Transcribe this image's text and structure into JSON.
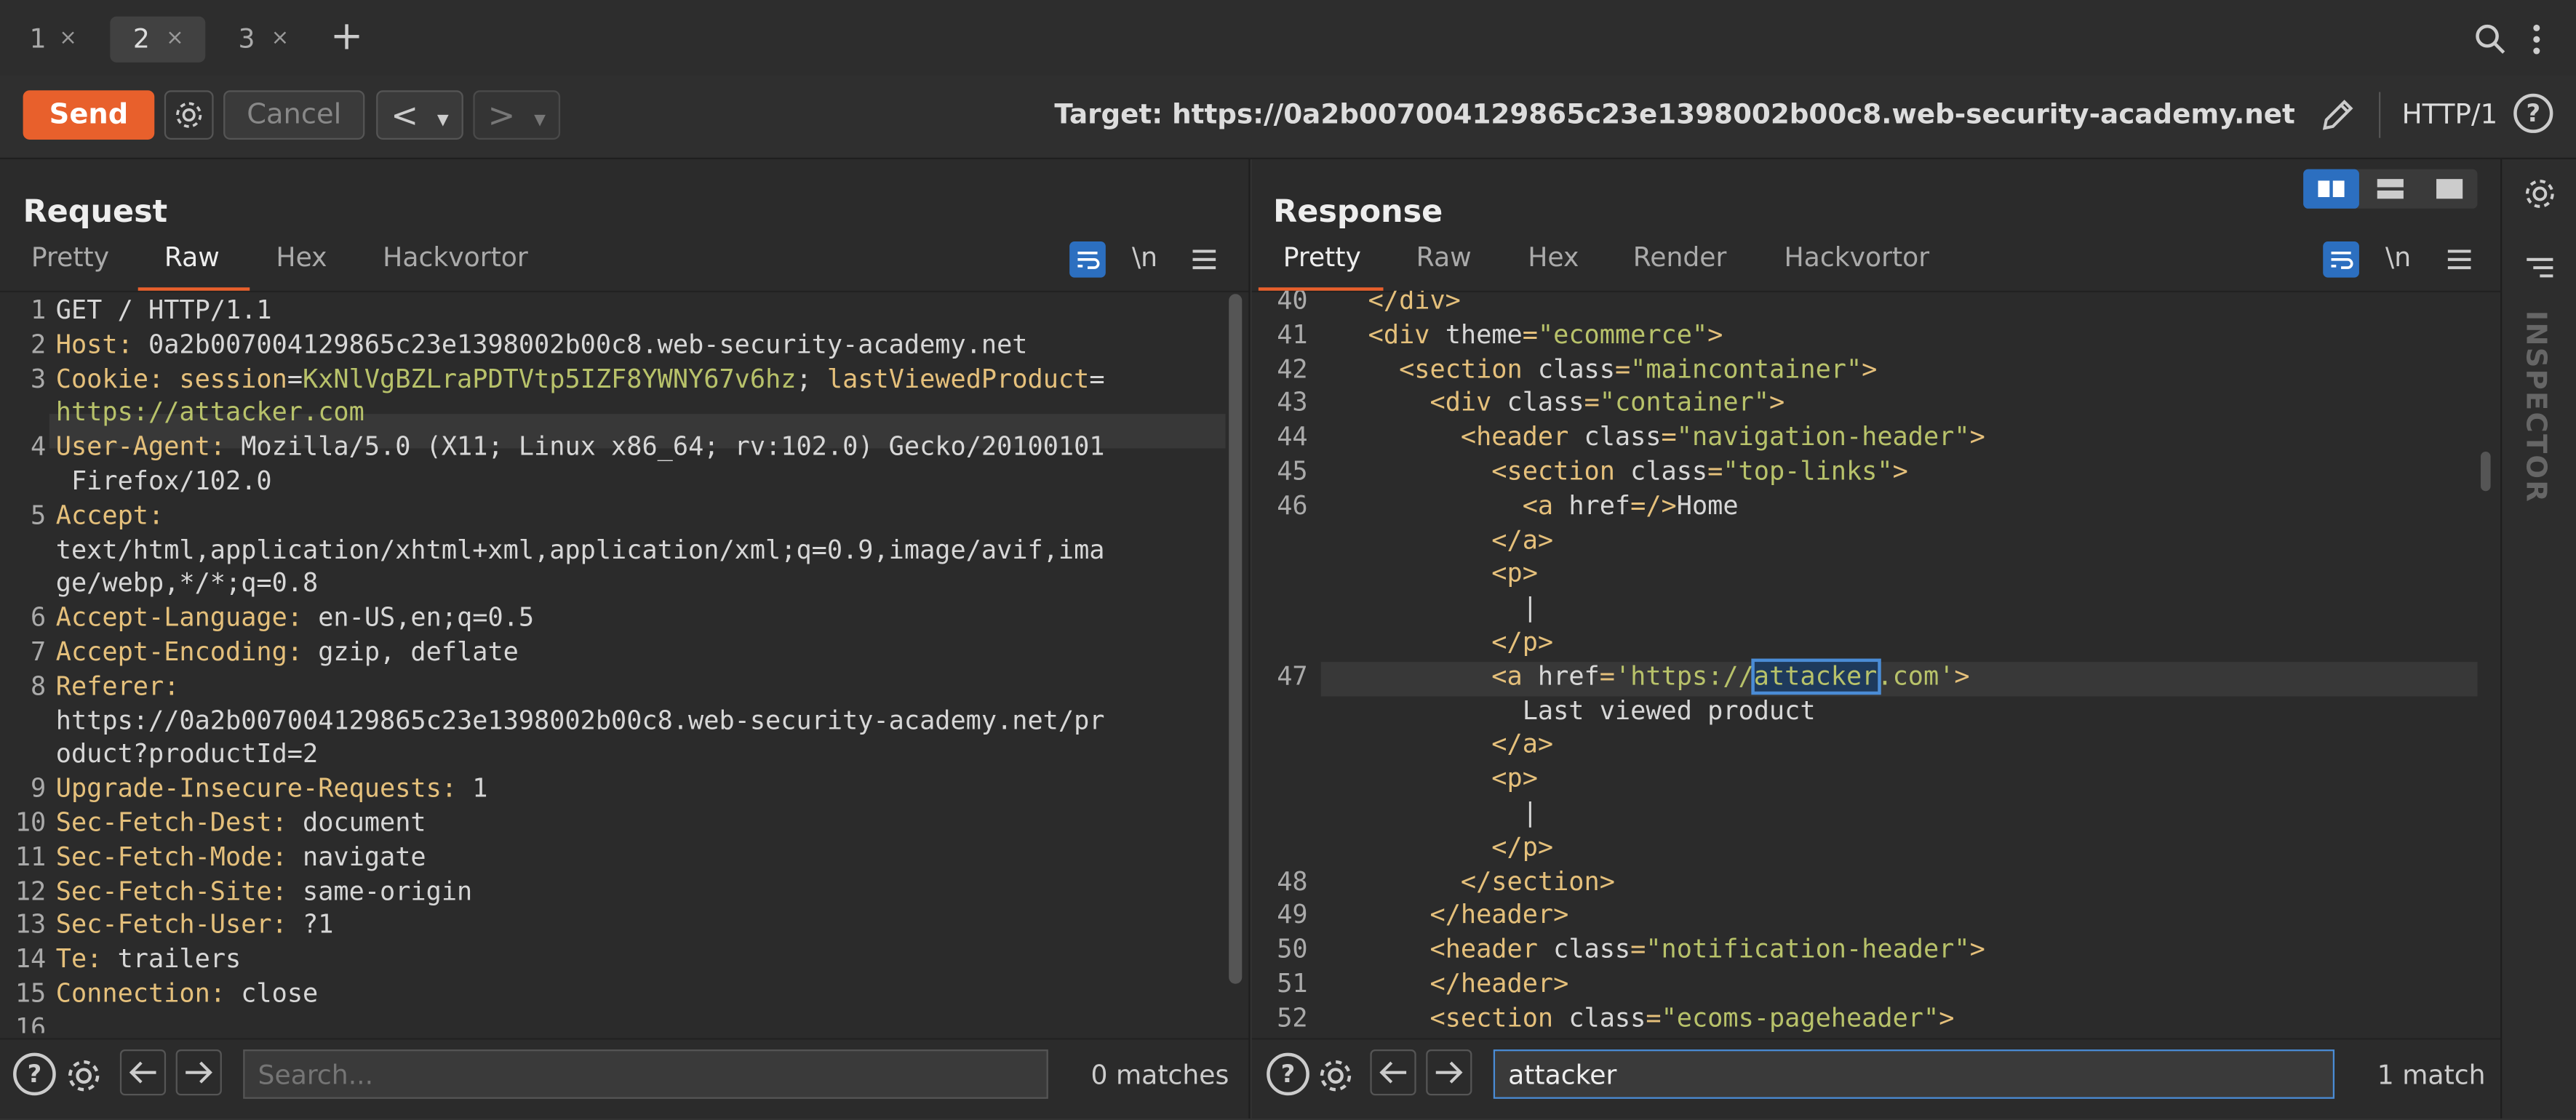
{
  "tabs": [
    {
      "label": "1"
    },
    {
      "label": "2"
    },
    {
      "label": "3"
    }
  ],
  "tab_close": "×",
  "new_tab": "+",
  "toolbar": {
    "send": "Send",
    "cancel": "Cancel",
    "back": "<",
    "forward": ">",
    "dropdown": "▾",
    "target_label": "Target:",
    "target_url": "https://0a2b007004129865c23e1398002b00c8.web-security-academy.net",
    "http_version": "HTTP/1",
    "help": "?"
  },
  "request": {
    "title": "Request",
    "tabs": [
      "Pretty",
      "Raw",
      "Hex",
      "Hackvortor"
    ],
    "active_tab": "Raw",
    "newline_toggle": "\\n",
    "lines": [
      {
        "n": "1",
        "name": "",
        "value": "GET / HTTP/1.1"
      },
      {
        "n": "2",
        "name": "Host",
        "value": " 0a2b007004129865c23e1398002b00c8.web-security-academy.net"
      },
      {
        "n": "3",
        "name": "Cookie",
        "value": ""
      },
      {
        "n": "",
        "name": "",
        "value": "https://attacker.com"
      },
      {
        "n": "4",
        "name": "User-Agent",
        "value": " Mozilla/5.0 (X11; Linux x86_64; rv:102.0) Gecko/20100101"
      },
      {
        "n": "",
        "name": "",
        "value": " Firefox/102.0"
      },
      {
        "n": "5",
        "name": "Accept",
        "value": ""
      },
      {
        "n": "",
        "name": "",
        "value": "text/html,application/xhtml+xml,application/xml;q=0.9,image/avif,ima"
      },
      {
        "n": "",
        "name": "",
        "value": "ge/webp,*/*;q=0.8"
      },
      {
        "n": "6",
        "name": "Accept-Language",
        "value": " en-US,en;q=0.5"
      },
      {
        "n": "7",
        "name": "Accept-Encoding",
        "value": " gzip, deflate"
      },
      {
        "n": "8",
        "name": "Referer",
        "value": ""
      },
      {
        "n": "",
        "name": "",
        "value": "https://0a2b007004129865c23e1398002b00c8.web-security-academy.net/pr"
      },
      {
        "n": "",
        "name": "",
        "value": "oduct?productId=2"
      },
      {
        "n": "9",
        "name": "Upgrade-Insecure-Requests",
        "value": " 1"
      },
      {
        "n": "10",
        "name": "Sec-Fetch-Dest",
        "value": " document"
      },
      {
        "n": "11",
        "name": "Sec-Fetch-Mode",
        "value": " navigate"
      },
      {
        "n": "12",
        "name": "Sec-Fetch-Site",
        "value": " same-origin"
      },
      {
        "n": "13",
        "name": "Sec-Fetch-User",
        "value": " ?1"
      },
      {
        "n": "14",
        "name": "Te",
        "value": " trailers"
      },
      {
        "n": "15",
        "name": "Connection",
        "value": " close"
      },
      {
        "n": "16",
        "name": "",
        "value": ""
      }
    ],
    "cookie_parts": {
      "k1": " session",
      "eq": "=",
      "v1": "KxNlVgBZLraPDTVtp5IZF8YWNY67v6hz",
      "sep": "; ",
      "k2": "lastViewedProduct",
      "eq2": "="
    },
    "search_placeholder": "Search...",
    "matches": "0 matches"
  },
  "response": {
    "title": "Response",
    "tabs": [
      "Pretty",
      "Raw",
      "Hex",
      "Render",
      "Hackvortor"
    ],
    "active_tab": "Pretty",
    "newline_toggle": "\\n",
    "lines": [
      {
        "n": "40",
        "indent": "  ",
        "html": [
          [
            "tag",
            "</div>"
          ]
        ]
      },
      {
        "n": "41",
        "indent": "  ",
        "html": [
          [
            "tag",
            "<div "
          ],
          [
            "attr",
            "theme"
          ],
          [
            "tag",
            "="
          ],
          [
            "val",
            "\"ecommerce\""
          ],
          [
            "tag",
            ">"
          ]
        ]
      },
      {
        "n": "42",
        "indent": "    ",
        "html": [
          [
            "tag",
            "<section "
          ],
          [
            "attr",
            "class"
          ],
          [
            "tag",
            "="
          ],
          [
            "val",
            "\"maincontainer\""
          ],
          [
            "tag",
            ">"
          ]
        ]
      },
      {
        "n": "43",
        "indent": "      ",
        "html": [
          [
            "tag",
            "<div "
          ],
          [
            "attr",
            "class"
          ],
          [
            "tag",
            "="
          ],
          [
            "val",
            "\"container\""
          ],
          [
            "tag",
            ">"
          ]
        ]
      },
      {
        "n": "44",
        "indent": "        ",
        "html": [
          [
            "tag",
            "<header "
          ],
          [
            "attr",
            "class"
          ],
          [
            "tag",
            "="
          ],
          [
            "val",
            "\"navigation-header\""
          ],
          [
            "tag",
            ">"
          ]
        ]
      },
      {
        "n": "45",
        "indent": "          ",
        "html": [
          [
            "tag",
            "<section "
          ],
          [
            "attr",
            "class"
          ],
          [
            "tag",
            "="
          ],
          [
            "val",
            "\"top-links\""
          ],
          [
            "tag",
            ">"
          ]
        ]
      },
      {
        "n": "46",
        "indent": "            ",
        "html": [
          [
            "tag",
            "<a "
          ],
          [
            "attr",
            "href"
          ],
          [
            "tag",
            "=/>"
          ],
          [
            "attr",
            "Home"
          ]
        ]
      },
      {
        "n": "",
        "indent": "          ",
        "html": [
          [
            "tag",
            "</a>"
          ]
        ]
      },
      {
        "n": "",
        "indent": "          ",
        "html": [
          [
            "tag",
            "<p>"
          ]
        ]
      },
      {
        "n": "",
        "indent": "            ",
        "html": [
          [
            "attr",
            "|"
          ]
        ]
      },
      {
        "n": "",
        "indent": "          ",
        "html": [
          [
            "tag",
            "</p>"
          ]
        ]
      },
      {
        "n": "47",
        "indent": "          ",
        "html": [
          [
            "tag",
            "<a "
          ],
          [
            "attr",
            "href"
          ],
          [
            "tag",
            "="
          ],
          [
            "val",
            "'https://"
          ],
          [
            "match",
            "attacker"
          ],
          [
            "val",
            ".com'"
          ],
          [
            "tag",
            ">"
          ]
        ]
      },
      {
        "n": "",
        "indent": "            ",
        "html": [
          [
            "attr",
            "Last viewed product"
          ]
        ]
      },
      {
        "n": "",
        "indent": "          ",
        "html": [
          [
            "tag",
            "</a>"
          ]
        ]
      },
      {
        "n": "",
        "indent": "          ",
        "html": [
          [
            "tag",
            "<p>"
          ]
        ]
      },
      {
        "n": "",
        "indent": "            ",
        "html": [
          [
            "attr",
            "|"
          ]
        ]
      },
      {
        "n": "",
        "indent": "          ",
        "html": [
          [
            "tag",
            "</p>"
          ]
        ]
      },
      {
        "n": "48",
        "indent": "        ",
        "html": [
          [
            "tag",
            "</section>"
          ]
        ]
      },
      {
        "n": "49",
        "indent": "      ",
        "html": [
          [
            "tag",
            "</header>"
          ]
        ]
      },
      {
        "n": "50",
        "indent": "      ",
        "html": [
          [
            "tag",
            "<header "
          ],
          [
            "attr",
            "class"
          ],
          [
            "tag",
            "="
          ],
          [
            "val",
            "\"notification-header\""
          ],
          [
            "tag",
            ">"
          ]
        ]
      },
      {
        "n": "51",
        "indent": "      ",
        "html": [
          [
            "tag",
            "</header>"
          ]
        ]
      },
      {
        "n": "52",
        "indent": "      ",
        "html": [
          [
            "tag",
            "<section "
          ],
          [
            "attr",
            "class"
          ],
          [
            "tag",
            "="
          ],
          [
            "val",
            "\"ecoms-pageheader\""
          ],
          [
            "tag",
            ">"
          ]
        ]
      }
    ],
    "search_value": "attacker",
    "matches": "1 match"
  },
  "inspector": {
    "label": "INSPECTOR"
  },
  "colors": {
    "accent": "#e8602c",
    "match_border": "#4a8cd6",
    "highlight_line": "#383838",
    "blue_btn": "#2c6fc0"
  }
}
